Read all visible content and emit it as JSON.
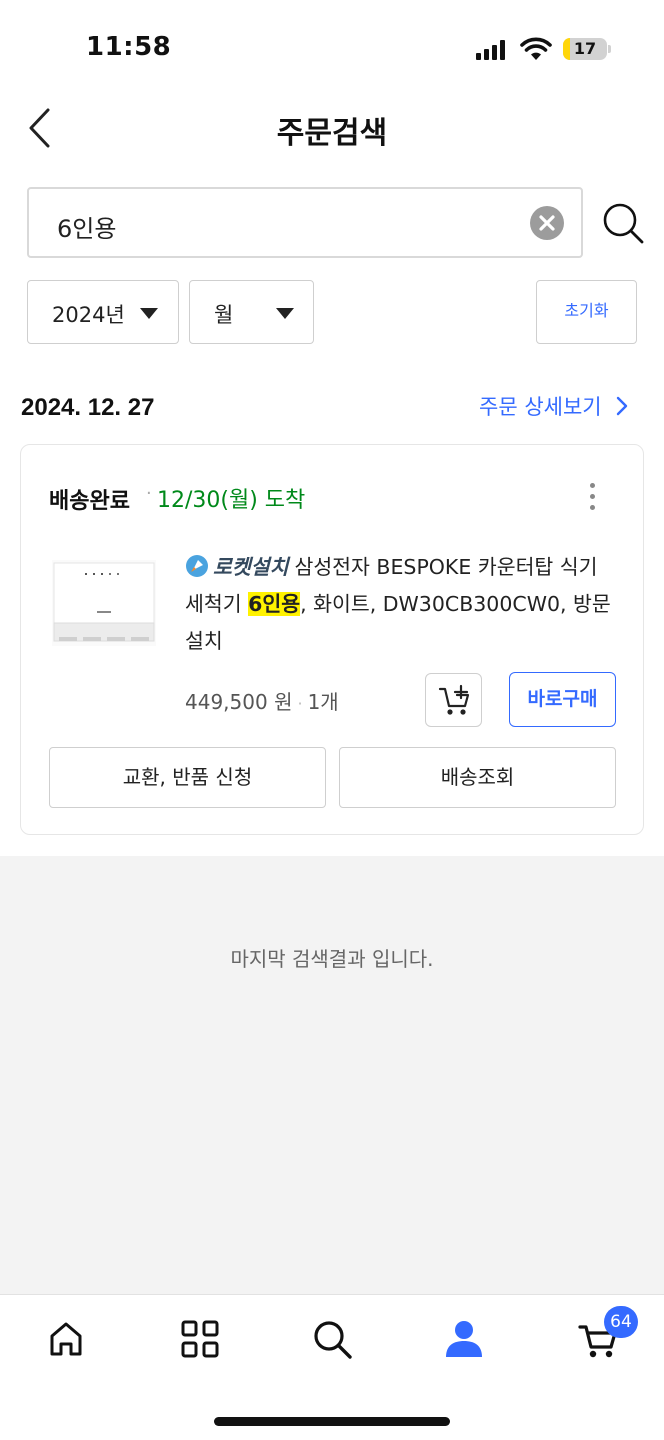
{
  "status_bar": {
    "time": "11:58",
    "battery": "17",
    "battery_level": 0.17
  },
  "header": {
    "title": "주문검색"
  },
  "search": {
    "value": "6인용"
  },
  "filters": {
    "year": "2024년",
    "month": "월",
    "reset": "초기화"
  },
  "order": {
    "date": "2024. 12. 27",
    "detail_link": "주문 상세보기",
    "status": "배송완료",
    "separator": "·",
    "arrival": "12/30(월) 도착",
    "product": {
      "badge": "로켓설치",
      "name_before": "삼성전자 BESPOKE 카운터탑 식기세척기 ",
      "name_highlight": "6인용",
      "name_after": ", 화이트, DW30CB300CW0, 방문설치",
      "price": "449,500 원",
      "quantity": "1개"
    },
    "buy_now": "바로구매",
    "exchange_return": "교환, 반품 신청",
    "track_delivery": "배송조회"
  },
  "end_message": "마지막 검색결과 입니다.",
  "tabbar": {
    "tabs": [
      "home-icon",
      "category-icon",
      "search-icon",
      "my-coupang-icon",
      "cart-icon"
    ],
    "cart_count": "64",
    "active_color": "#346aff"
  },
  "colors": {
    "accent": "#346aff",
    "arrival_green": "#00891a",
    "highlight": "#fff200"
  }
}
